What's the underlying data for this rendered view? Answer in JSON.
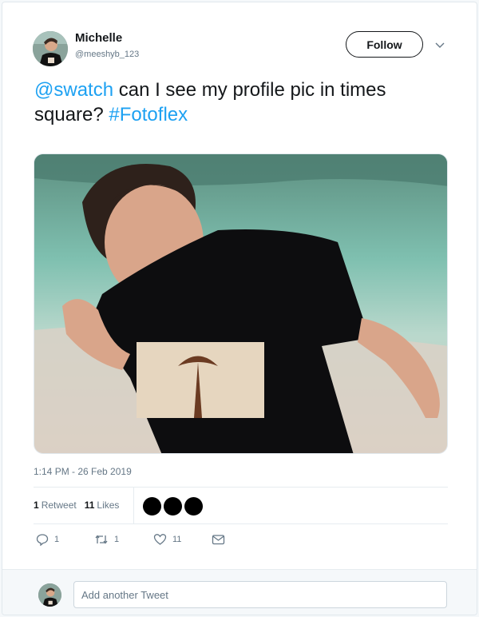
{
  "author": {
    "name": "Michelle",
    "handle": "@meeshyb_123"
  },
  "header": {
    "follow_label": "Follow"
  },
  "tweet": {
    "mention": "@swatch",
    "text": " can I see my profile pic in times square? ",
    "hashtag": "#Fotoflex",
    "timestamp": "1:14 PM - 26 Feb 2019"
  },
  "stats": {
    "retweets_count": "1",
    "retweets_label": "Retweet",
    "likes_count": "11",
    "likes_label": "Likes"
  },
  "actions": {
    "reply_count": "1",
    "retweet_count": "1",
    "like_count": "11"
  },
  "reply": {
    "placeholder": "Add another Tweet"
  },
  "icons": {
    "caret": "chevron-down-icon",
    "reply": "reply-icon",
    "retweet": "retweet-icon",
    "like": "heart-icon",
    "dm": "envelope-icon"
  },
  "colors": {
    "link": "#1da1f2",
    "text": "#14171a",
    "muted": "#657786"
  }
}
